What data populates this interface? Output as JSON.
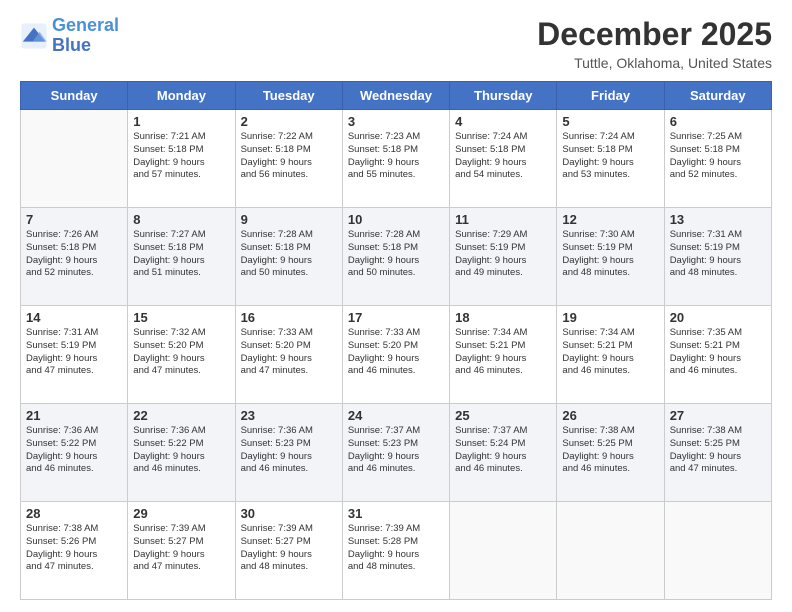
{
  "header": {
    "logo_line1": "General",
    "logo_line2": "Blue",
    "month": "December 2025",
    "location": "Tuttle, Oklahoma, United States"
  },
  "weekdays": [
    "Sunday",
    "Monday",
    "Tuesday",
    "Wednesday",
    "Thursday",
    "Friday",
    "Saturday"
  ],
  "weeks": [
    [
      {
        "day": "",
        "info": ""
      },
      {
        "day": "1",
        "info": "Sunrise: 7:21 AM\nSunset: 5:18 PM\nDaylight: 9 hours\nand 57 minutes."
      },
      {
        "day": "2",
        "info": "Sunrise: 7:22 AM\nSunset: 5:18 PM\nDaylight: 9 hours\nand 56 minutes."
      },
      {
        "day": "3",
        "info": "Sunrise: 7:23 AM\nSunset: 5:18 PM\nDaylight: 9 hours\nand 55 minutes."
      },
      {
        "day": "4",
        "info": "Sunrise: 7:24 AM\nSunset: 5:18 PM\nDaylight: 9 hours\nand 54 minutes."
      },
      {
        "day": "5",
        "info": "Sunrise: 7:24 AM\nSunset: 5:18 PM\nDaylight: 9 hours\nand 53 minutes."
      },
      {
        "day": "6",
        "info": "Sunrise: 7:25 AM\nSunset: 5:18 PM\nDaylight: 9 hours\nand 52 minutes."
      }
    ],
    [
      {
        "day": "7",
        "info": "Sunrise: 7:26 AM\nSunset: 5:18 PM\nDaylight: 9 hours\nand 52 minutes."
      },
      {
        "day": "8",
        "info": "Sunrise: 7:27 AM\nSunset: 5:18 PM\nDaylight: 9 hours\nand 51 minutes."
      },
      {
        "day": "9",
        "info": "Sunrise: 7:28 AM\nSunset: 5:18 PM\nDaylight: 9 hours\nand 50 minutes."
      },
      {
        "day": "10",
        "info": "Sunrise: 7:28 AM\nSunset: 5:18 PM\nDaylight: 9 hours\nand 50 minutes."
      },
      {
        "day": "11",
        "info": "Sunrise: 7:29 AM\nSunset: 5:19 PM\nDaylight: 9 hours\nand 49 minutes."
      },
      {
        "day": "12",
        "info": "Sunrise: 7:30 AM\nSunset: 5:19 PM\nDaylight: 9 hours\nand 48 minutes."
      },
      {
        "day": "13",
        "info": "Sunrise: 7:31 AM\nSunset: 5:19 PM\nDaylight: 9 hours\nand 48 minutes."
      }
    ],
    [
      {
        "day": "14",
        "info": "Sunrise: 7:31 AM\nSunset: 5:19 PM\nDaylight: 9 hours\nand 47 minutes."
      },
      {
        "day": "15",
        "info": "Sunrise: 7:32 AM\nSunset: 5:20 PM\nDaylight: 9 hours\nand 47 minutes."
      },
      {
        "day": "16",
        "info": "Sunrise: 7:33 AM\nSunset: 5:20 PM\nDaylight: 9 hours\nand 47 minutes."
      },
      {
        "day": "17",
        "info": "Sunrise: 7:33 AM\nSunset: 5:20 PM\nDaylight: 9 hours\nand 46 minutes."
      },
      {
        "day": "18",
        "info": "Sunrise: 7:34 AM\nSunset: 5:21 PM\nDaylight: 9 hours\nand 46 minutes."
      },
      {
        "day": "19",
        "info": "Sunrise: 7:34 AM\nSunset: 5:21 PM\nDaylight: 9 hours\nand 46 minutes."
      },
      {
        "day": "20",
        "info": "Sunrise: 7:35 AM\nSunset: 5:21 PM\nDaylight: 9 hours\nand 46 minutes."
      }
    ],
    [
      {
        "day": "21",
        "info": "Sunrise: 7:36 AM\nSunset: 5:22 PM\nDaylight: 9 hours\nand 46 minutes."
      },
      {
        "day": "22",
        "info": "Sunrise: 7:36 AM\nSunset: 5:22 PM\nDaylight: 9 hours\nand 46 minutes."
      },
      {
        "day": "23",
        "info": "Sunrise: 7:36 AM\nSunset: 5:23 PM\nDaylight: 9 hours\nand 46 minutes."
      },
      {
        "day": "24",
        "info": "Sunrise: 7:37 AM\nSunset: 5:23 PM\nDaylight: 9 hours\nand 46 minutes."
      },
      {
        "day": "25",
        "info": "Sunrise: 7:37 AM\nSunset: 5:24 PM\nDaylight: 9 hours\nand 46 minutes."
      },
      {
        "day": "26",
        "info": "Sunrise: 7:38 AM\nSunset: 5:25 PM\nDaylight: 9 hours\nand 46 minutes."
      },
      {
        "day": "27",
        "info": "Sunrise: 7:38 AM\nSunset: 5:25 PM\nDaylight: 9 hours\nand 47 minutes."
      }
    ],
    [
      {
        "day": "28",
        "info": "Sunrise: 7:38 AM\nSunset: 5:26 PM\nDaylight: 9 hours\nand 47 minutes."
      },
      {
        "day": "29",
        "info": "Sunrise: 7:39 AM\nSunset: 5:27 PM\nDaylight: 9 hours\nand 47 minutes."
      },
      {
        "day": "30",
        "info": "Sunrise: 7:39 AM\nSunset: 5:27 PM\nDaylight: 9 hours\nand 48 minutes."
      },
      {
        "day": "31",
        "info": "Sunrise: 7:39 AM\nSunset: 5:28 PM\nDaylight: 9 hours\nand 48 minutes."
      },
      {
        "day": "",
        "info": ""
      },
      {
        "day": "",
        "info": ""
      },
      {
        "day": "",
        "info": ""
      }
    ]
  ]
}
